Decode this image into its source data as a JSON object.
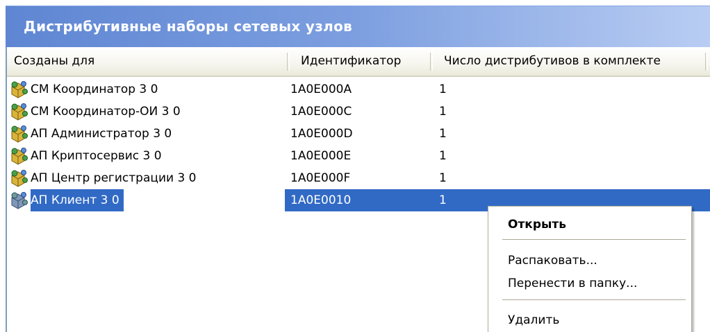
{
  "window": {
    "title": "Дистрибутивные наборы сетевых узлов"
  },
  "columns": {
    "name": "Созданы для",
    "id": "Идентификатор",
    "count": "Число дистрибутивов в комплекте"
  },
  "rows": [
    {
      "name": "СМ Координатор 3 0",
      "id": "1A0E000A",
      "count": "1",
      "icon": "package-icon",
      "selected": false
    },
    {
      "name": "СМ Координатор-ОИ 3 0",
      "id": "1A0E000C",
      "count": "1",
      "icon": "package-icon",
      "selected": false
    },
    {
      "name": "АП Администратор 3 0",
      "id": "1A0E000D",
      "count": "1",
      "icon": "package-icon",
      "selected": false
    },
    {
      "name": "АП Криптосервис 3 0",
      "id": "1A0E000E",
      "count": "1",
      "icon": "package-icon",
      "selected": false
    },
    {
      "name": "АП Центр регистрации 3 0",
      "id": "1A0E000F",
      "count": "1",
      "icon": "package-icon",
      "selected": false
    },
    {
      "name": "АП Клиент 3 0",
      "id": "1A0E0010",
      "count": "1",
      "icon": "package-icon",
      "selected": true
    }
  ],
  "context_menu": {
    "open": "Открыть",
    "unpack": "Распаковать...",
    "move": "Перенести в папку...",
    "delete": "Удалить"
  },
  "colors": {
    "title_gradient_start": "#5f86d3",
    "title_gradient_end": "#b9cdf3",
    "selection": "#316ac5"
  }
}
